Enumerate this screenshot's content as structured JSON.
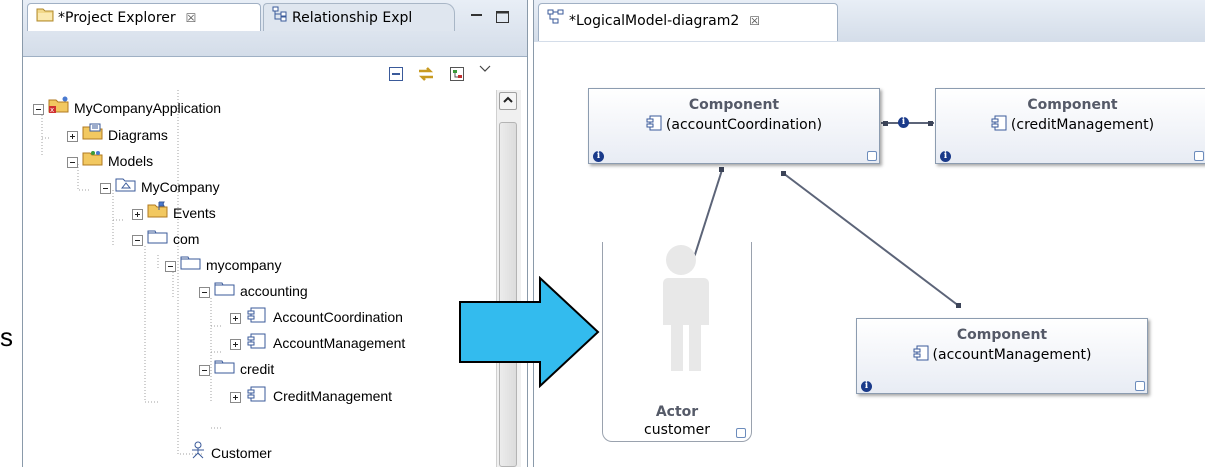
{
  "left_panel": {
    "tabs": [
      {
        "label": "*Project Explorer",
        "close": "☒"
      },
      {
        "label": "Relationship Expl"
      }
    ],
    "tree": [
      {
        "label": "MyCompanyApplication",
        "expander": "minus",
        "icon": "project"
      },
      {
        "label": "Diagrams",
        "expander": "plus",
        "icon": "diagrams-folder"
      },
      {
        "label": "Models",
        "expander": "minus",
        "icon": "models-folder"
      },
      {
        "label": "MyCompany",
        "expander": "minus",
        "icon": "model"
      },
      {
        "label": "Events",
        "expander": "plus",
        "icon": "events-folder"
      },
      {
        "label": "com",
        "expander": "minus",
        "icon": "package"
      },
      {
        "label": "mycompany",
        "expander": "minus",
        "icon": "package"
      },
      {
        "label": "accounting",
        "expander": "minus",
        "icon": "package"
      },
      {
        "label": "AccountCoordination",
        "expander": "plus",
        "icon": "component"
      },
      {
        "label": "AccountManagement",
        "expander": "plus",
        "icon": "component"
      },
      {
        "label": "credit",
        "expander": "minus",
        "icon": "package"
      },
      {
        "label": "CreditManagement",
        "expander": "plus",
        "icon": "component"
      },
      {
        "label": "Customer",
        "expander": "none",
        "icon": "actor"
      }
    ]
  },
  "edge_text": "s",
  "right_panel": {
    "tab": {
      "label": "*LogicalModel-diagram2",
      "close": "☒"
    },
    "components": [
      {
        "title": "Component",
        "name": "(accountCoordination)"
      },
      {
        "title": "Component",
        "name": "(creditManagement)"
      },
      {
        "title": "Component",
        "name": "(accountManagement)"
      }
    ],
    "actor": {
      "title": "Actor",
      "name": "customer"
    },
    "info_glyph": "i"
  },
  "colors": {
    "arrow_fill": "#33bbee",
    "component_title": "#555a68",
    "info_badge": "#1a3a8a",
    "connector": "#5c6478"
  }
}
